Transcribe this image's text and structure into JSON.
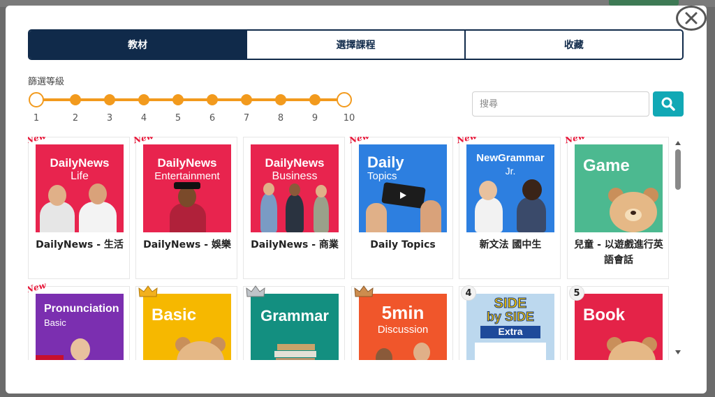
{
  "tabs": [
    {
      "label": "教材",
      "active": true
    },
    {
      "label": "選擇課程",
      "active": false
    },
    {
      "label": "收藏",
      "active": false
    }
  ],
  "filter": {
    "label": "篩選等級",
    "levels": [
      "1",
      "2",
      "3",
      "4",
      "5",
      "6",
      "7",
      "8",
      "9",
      "10"
    ],
    "range_min": 1,
    "range_max": 10
  },
  "search": {
    "placeholder": "搜尋",
    "value": ""
  },
  "badges": {
    "new": "New",
    "num4": "4",
    "num5": "5"
  },
  "covers": {
    "c1": [
      "DailyNews",
      "Life"
    ],
    "c2": [
      "DailyNews",
      "Entertainment"
    ],
    "c3": [
      "DailyNews",
      "Business"
    ],
    "c4": [
      "Daily",
      "Topics"
    ],
    "c5": [
      "NewGrammar",
      "Jr."
    ],
    "c6": [
      "Game"
    ],
    "c7": [
      "Pronunciation",
      "Basic"
    ],
    "c8": [
      "Basic"
    ],
    "c9": [
      "Grammar"
    ],
    "c10": [
      "5min",
      "Discussion"
    ],
    "c11": [
      "SIDE",
      "by SIDE",
      "Extra"
    ],
    "c12": [
      "Book"
    ]
  },
  "cards_row1": [
    {
      "name": "DailyNews - 生活",
      "color": "#e8244e"
    },
    {
      "name": "DailyNews - 娛樂",
      "color": "#e8244e"
    },
    {
      "name": "DailyNews - 商業",
      "color": "#e8244e"
    },
    {
      "name": "Daily Topics",
      "color": "#2d7fe0"
    },
    {
      "name": "新文法 國中生",
      "color": "#2d7fe0"
    },
    {
      "name": "兒童 - 以遊戲進行英語會話",
      "color": "#4cb990"
    }
  ],
  "cards_row2": [
    {
      "color": "#7b2fb0",
      "badge": "new"
    },
    {
      "color": "#f6b800",
      "badge": "gold-crown"
    },
    {
      "color": "#138f80",
      "badge": "silver-crown"
    },
    {
      "color": "#f0562b",
      "badge": "bronze-crown"
    },
    {
      "color": "#bcd8ee",
      "badge": "4"
    },
    {
      "color": "#e42348",
      "badge": "5"
    }
  ],
  "colors": {
    "navy": "#102a4a",
    "orange": "#f29a1d",
    "teal": "#11a8b5",
    "new_red": "#e8183a"
  }
}
